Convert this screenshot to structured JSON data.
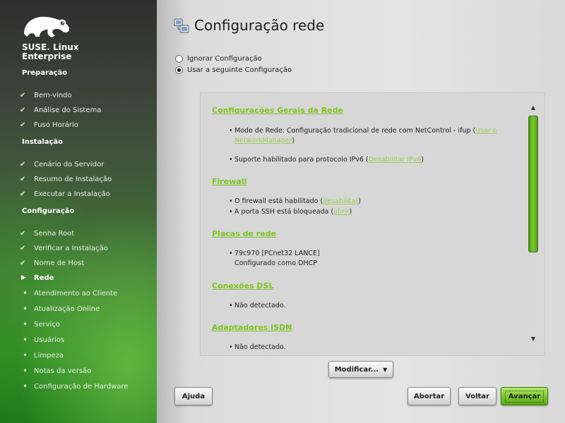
{
  "brand": {
    "name": "SUSE. Linux Enterprise"
  },
  "sidebar": {
    "sections": [
      {
        "title": "Preparação",
        "steps": [
          {
            "label": "Bem-vindo",
            "state": "done"
          },
          {
            "label": "Análise do Sistema",
            "state": "done"
          },
          {
            "label": "Fuso Horário",
            "state": "done"
          }
        ]
      },
      {
        "title": "Instalação",
        "steps": [
          {
            "label": "Cenário do Servidor",
            "state": "done"
          },
          {
            "label": "Resumo de Instalação",
            "state": "done"
          },
          {
            "label": "Executar a Instalação",
            "state": "done"
          }
        ]
      },
      {
        "title": "Configuração",
        "steps": [
          {
            "label": "Senha Root",
            "state": "done"
          },
          {
            "label": "Verificar a Instalação",
            "state": "done"
          },
          {
            "label": "Nome de Host",
            "state": "done"
          },
          {
            "label": "Rede",
            "state": "current"
          },
          {
            "label": "Atendimento ao Cliente",
            "state": "todo"
          },
          {
            "label": "Atualização Online",
            "state": "todo"
          },
          {
            "label": "Serviço",
            "state": "todo"
          },
          {
            "label": "Usuários",
            "state": "todo"
          },
          {
            "label": "Limpeza",
            "state": "todo"
          },
          {
            "label": "Notas da versão",
            "state": "todo"
          },
          {
            "label": "Configuração de Hardware",
            "state": "todo"
          }
        ]
      }
    ]
  },
  "main": {
    "title": "Configuração rede",
    "title_icon": "network-config-icon",
    "options": [
      {
        "label": "Ignorar Configuração",
        "selected": false
      },
      {
        "label": "Usar a seguinte Configuração",
        "selected": true
      }
    ],
    "content": {
      "general": {
        "heading": "Configurações Gerais da Rede",
        "mode_text": "Modo de Rede: Configuração tradicional de rede com NetControl - ifup (",
        "mode_link": "Usar o NetworkManager",
        "mode_close": ")",
        "ipv6_text": "Suporte habilitado para protocolo IPv6 (",
        "ipv6_link": "Desabilitar IPv6",
        "ipv6_close": ")"
      },
      "firewall": {
        "heading": "Firewall",
        "fw_text": "O firewall está habilitado (",
        "fw_link": "desabilitar",
        "fw_close": ")",
        "ssh_text": "A porta SSH está bloqueada (",
        "ssh_link": "abrir",
        "ssh_close": ")"
      },
      "nics": {
        "heading": "Placas de rede",
        "card_line1": "79c970 [PCnet32 LANCE]",
        "card_line2": "Configurado como DHCP"
      },
      "dsl": {
        "heading": "Conexões DSL",
        "status": "Não detectado."
      },
      "isdn": {
        "heading": "Adaptadores ISDN",
        "status": "Não detectado."
      }
    }
  },
  "buttons": {
    "modify": "Modificar...",
    "help": "Ajuda",
    "abort": "Abortar",
    "back": "Voltar",
    "next": "Avançar"
  },
  "colors": {
    "accent": "#7dc31f",
    "sidebar_green": "#2e8a22"
  }
}
